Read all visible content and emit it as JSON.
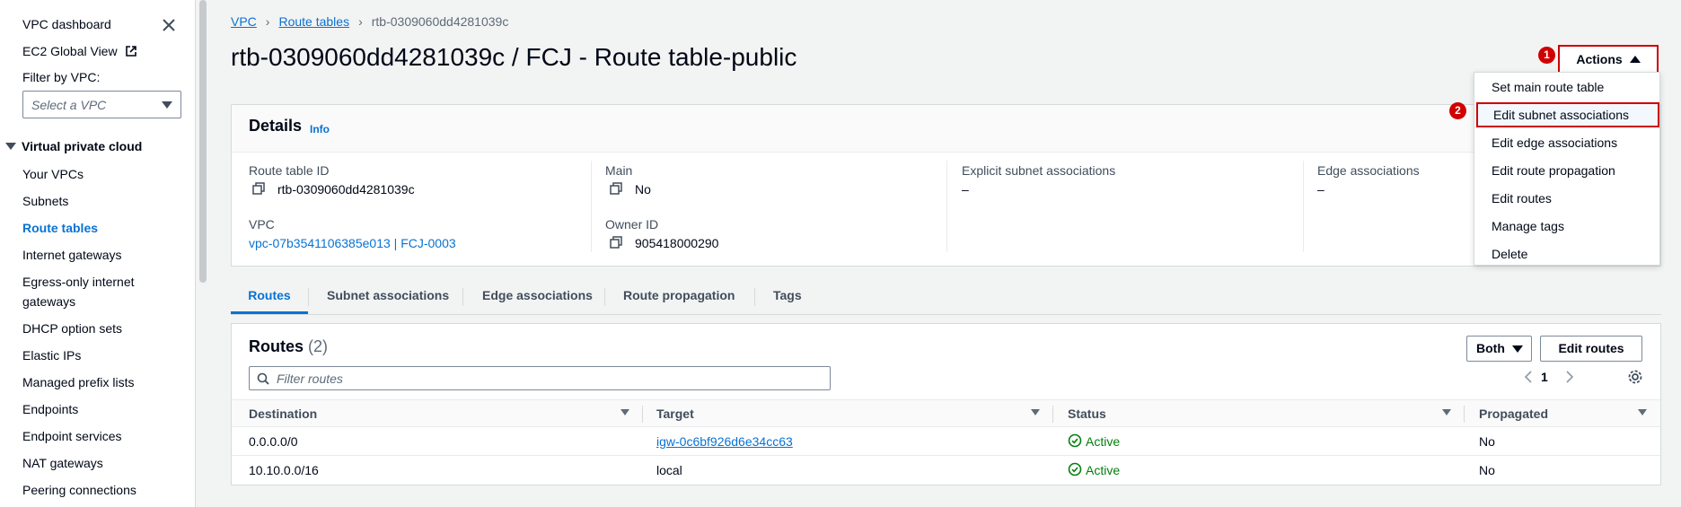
{
  "sidebar": {
    "dashboard": "VPC dashboard",
    "ec2_global": "EC2 Global View",
    "filter_label": "Filter by VPC:",
    "select_placeholder": "Select a VPC",
    "section": "Virtual private cloud",
    "items": [
      {
        "label": "Your VPCs"
      },
      {
        "label": "Subnets"
      },
      {
        "label": "Route tables"
      },
      {
        "label": "Internet gateways"
      },
      {
        "label": "Egress-only internet"
      },
      {
        "label": "gateways"
      },
      {
        "label": "DHCP option sets"
      },
      {
        "label": "Elastic IPs"
      },
      {
        "label": "Managed prefix lists"
      },
      {
        "label": "Endpoints"
      },
      {
        "label": "Endpoint services"
      },
      {
        "label": "NAT gateways"
      },
      {
        "label": "Peering connections"
      }
    ]
  },
  "breadcrumb": {
    "vpc": "VPC",
    "route_tables": "Route tables",
    "current": "rtb-0309060dd4281039c"
  },
  "page_title": "rtb-0309060dd4281039c / FCJ - Route table-public",
  "actions": {
    "label": "Actions",
    "badge1": "1",
    "badge2": "2",
    "menu": [
      "Set main route table",
      "Edit subnet associations",
      "Edit edge associations",
      "Edit route propagation",
      "Edit routes",
      "Manage tags",
      "Delete"
    ]
  },
  "details": {
    "title": "Details",
    "info": "Info",
    "route_table_id_label": "Route table ID",
    "route_table_id": "rtb-0309060dd4281039c",
    "main_label": "Main",
    "main": "No",
    "explicit_label": "Explicit subnet associations",
    "explicit": "–",
    "edge_label": "Edge associations",
    "edge": "–",
    "vpc_label": "VPC",
    "vpc": "vpc-07b3541106385e013 | FCJ-0003",
    "owner_label": "Owner ID",
    "owner": "905418000290"
  },
  "tabs": [
    "Routes",
    "Subnet associations",
    "Edge associations",
    "Route propagation",
    "Tags"
  ],
  "routes": {
    "title": "Routes",
    "count": "(2)",
    "both": "Both",
    "edit_routes": "Edit routes",
    "filter_placeholder": "Filter routes",
    "page": "1",
    "columns": [
      "Destination",
      "Target",
      "Status",
      "Propagated"
    ],
    "rows": [
      {
        "destination": "0.0.0.0/0",
        "target": "igw-0c6bf926d6e34cc63",
        "status": "Active",
        "propagated": "No"
      },
      {
        "destination": "10.10.0.0/16",
        "target": "local",
        "status": "Active",
        "propagated": "No"
      }
    ]
  },
  "colors": {
    "link": "#0972d3",
    "active": "#037f0c",
    "highlight": "#cc0000"
  }
}
